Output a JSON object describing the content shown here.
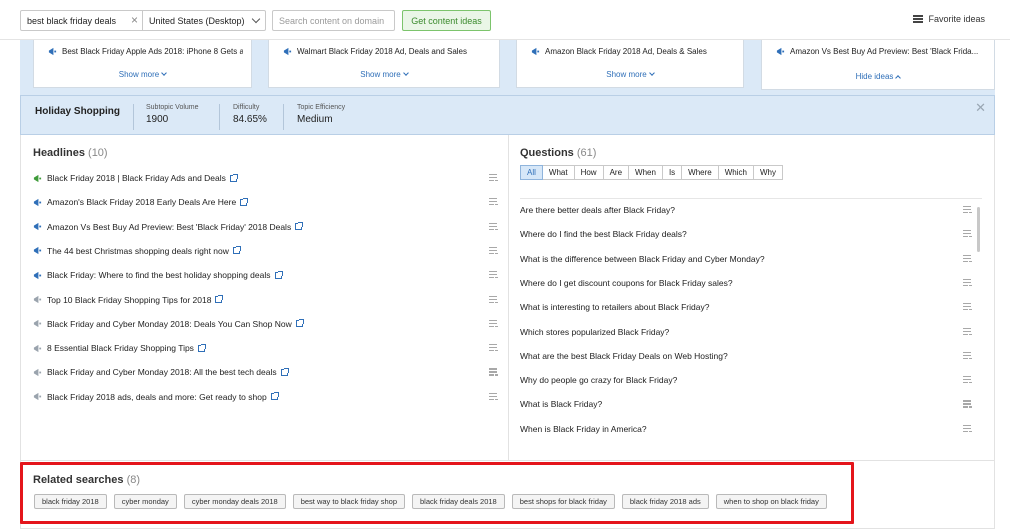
{
  "topbar": {
    "keyword": "best black friday deals",
    "database": "United States (Desktop)",
    "domain_placeholder": "Search content on domain",
    "get_ideas_label": "Get content ideas",
    "favorite_label": "Favorite ideas"
  },
  "cards": [
    {
      "title": "Best Black Friday Apple Ads 2018: iPhone 8 Gets a...",
      "action": "Show more"
    },
    {
      "title": "Walmart Black Friday 2018 Ad, Deals and Sales",
      "action": "Show more"
    },
    {
      "title": "Amazon Black Friday 2018 Ad, Deals & Sales",
      "action": "Show more"
    },
    {
      "title": "Amazon Vs Best Buy Ad Preview: Best 'Black Frida...",
      "action": "Hide ideas"
    }
  ],
  "topic": {
    "title": "Holiday Shopping",
    "stats": [
      {
        "label": "Subtopic Volume",
        "value": "1900"
      },
      {
        "label": "Difficulty",
        "value": "84.65%"
      },
      {
        "label": "Topic Efficiency",
        "value": "Medium"
      }
    ]
  },
  "headlines": {
    "title": "Headlines",
    "count": "(10)",
    "items": [
      "Black Friday 2018 | Black Friday Ads and Deals",
      "Amazon's Black Friday 2018 Early Deals Are Here",
      "Amazon Vs Best Buy Ad Preview: Best 'Black Friday' 2018 Deals",
      "The 44 best Christmas shopping deals right now",
      "Black Friday: Where to find the best holiday shopping deals",
      "Top 10 Black Friday Shopping Tips for 2018",
      "Black Friday and Cyber Monday 2018: Deals You Can Shop Now",
      "8 Essential Black Friday Shopping Tips",
      "Black Friday and Cyber Monday 2018: All the best tech deals",
      "Black Friday 2018 ads, deals and more: Get ready to shop"
    ]
  },
  "questions": {
    "title": "Questions",
    "count": "(61)",
    "filters": [
      "All",
      "What",
      "How",
      "Are",
      "When",
      "Is",
      "Where",
      "Which",
      "Why"
    ],
    "items": [
      "Are there better deals after Black Friday?",
      "Where do I find the best Black Friday deals?",
      "What is the difference between Black Friday and Cyber Monday?",
      "Where do I get discount coupons for Black Friday sales?",
      "What is interesting to retailers about Black Friday?",
      "Which stores popularized Black Friday?",
      "What are the best Black Friday Deals on Web Hosting?",
      "Why do people go crazy for Black Friday?",
      "What is Black Friday?",
      "When is Black Friday in America?"
    ]
  },
  "related": {
    "title": "Related searches",
    "count": "(8)",
    "tags": [
      "black friday 2018",
      "cyber monday",
      "cyber monday deals 2018",
      "best way to black friday shop",
      "black friday deals 2018",
      "best shops for black friday",
      "black friday 2018 ads",
      "when to shop on black friday"
    ]
  }
}
